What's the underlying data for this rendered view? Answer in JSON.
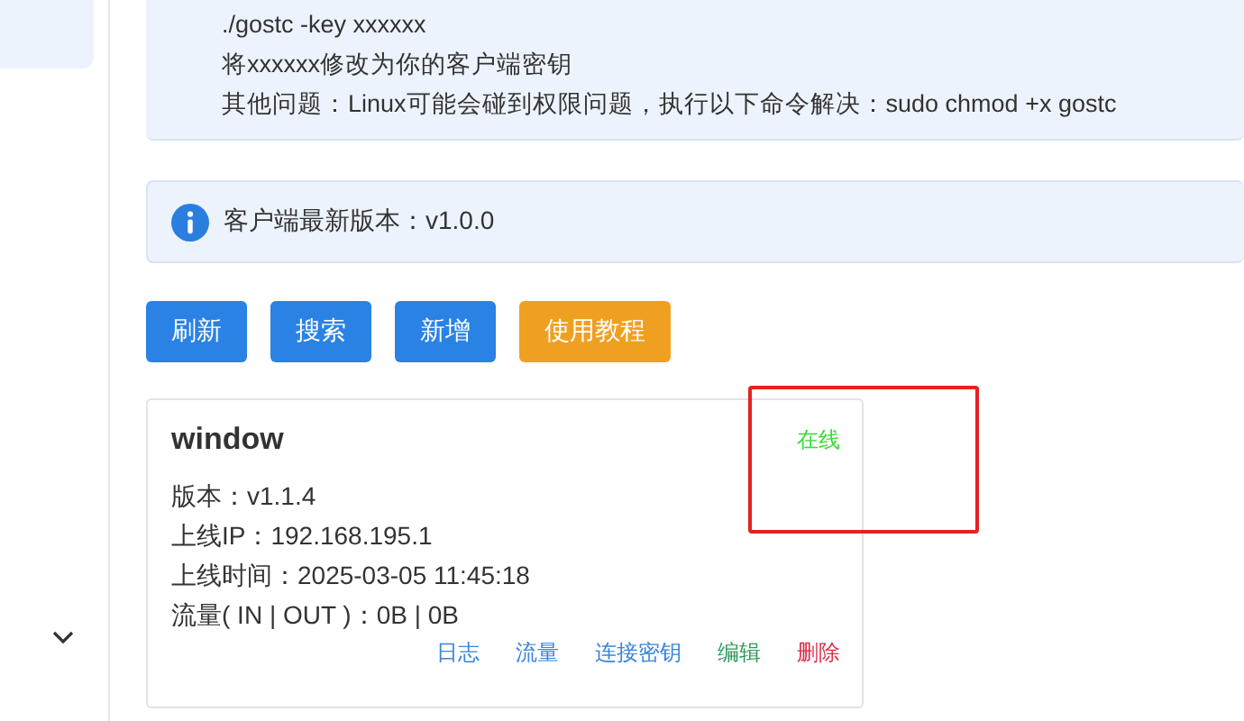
{
  "notice": {
    "lines": [
      "./gostc -key xxxxxx",
      "将xxxxxx修改为你的客户端密钥",
      "其他问题：Linux可能会碰到权限问题，执行以下命令解决：sudo chmod +x gostc"
    ]
  },
  "info": {
    "text": "客户端最新版本：v1.0.0"
  },
  "buttons": [
    {
      "label": "刷新",
      "kind": "primary"
    },
    {
      "label": "搜索",
      "kind": "primary"
    },
    {
      "label": "新增",
      "kind": "primary"
    },
    {
      "label": "使用教程",
      "kind": "warning"
    }
  ],
  "client": {
    "name": "window",
    "status": "在线",
    "online": true,
    "fields": [
      "版本：v1.1.4",
      "上线IP：192.168.195.1",
      "上线时间：2025-03-05 11:45:18",
      "流量( IN | OUT )：0B | 0B"
    ],
    "actions": [
      {
        "label": "日志",
        "color": "#3a86d9"
      },
      {
        "label": "流量",
        "color": "#3a86d9"
      },
      {
        "label": "连接密钥",
        "color": "#3a86d9"
      },
      {
        "label": "编辑",
        "color": "#2e9a5a"
      },
      {
        "label": "删除",
        "color": "#d9304a"
      }
    ]
  }
}
